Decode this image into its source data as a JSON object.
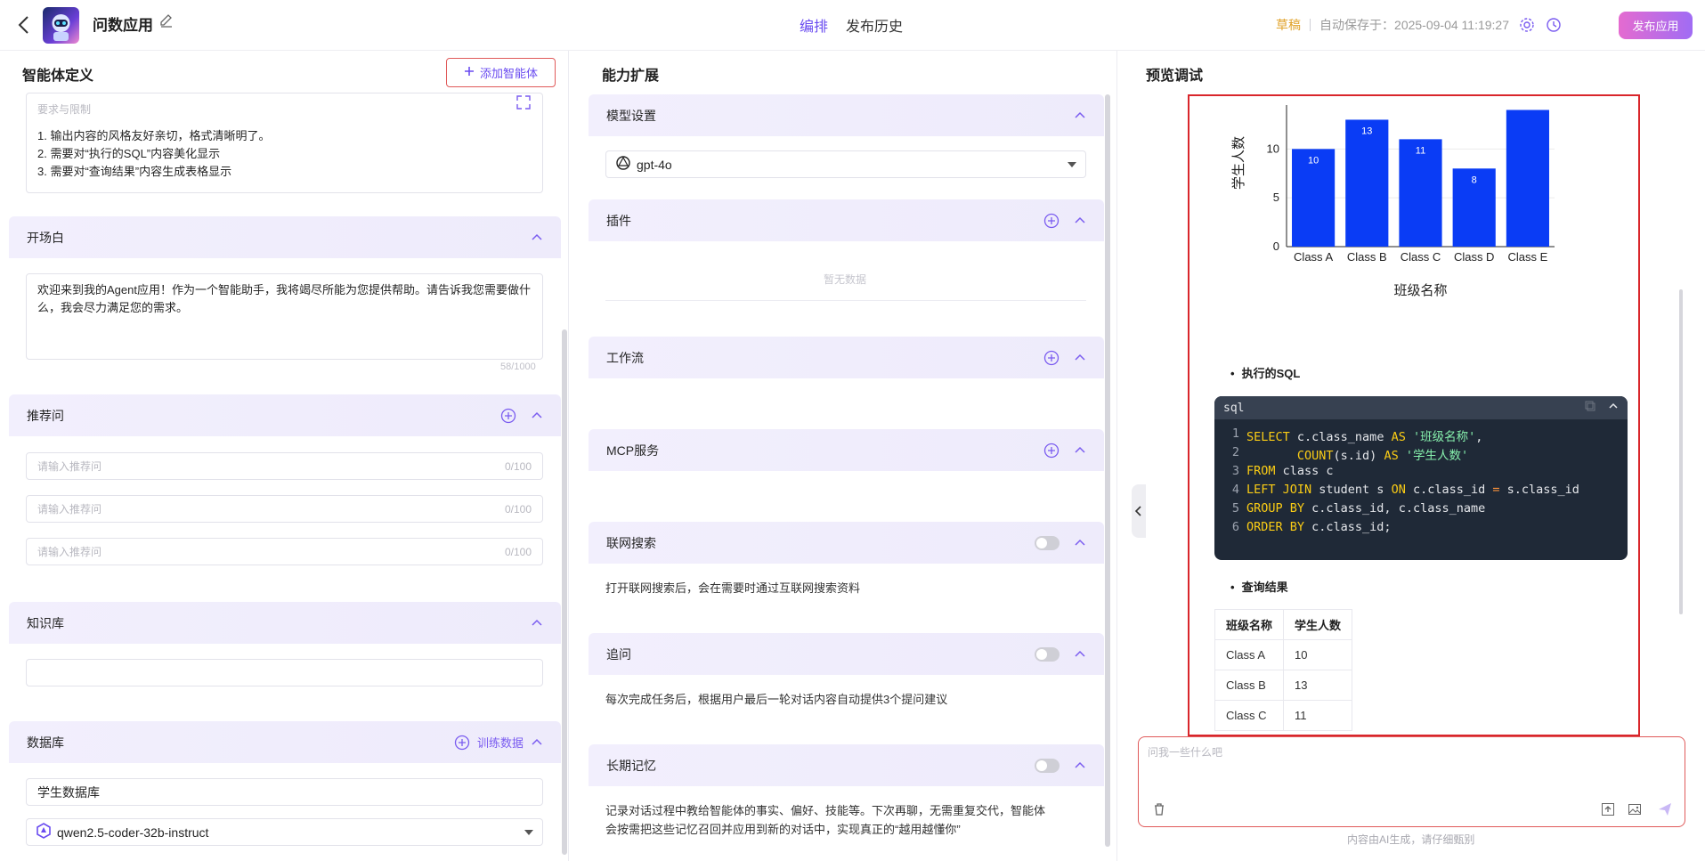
{
  "header": {
    "app_name": "问数应用",
    "tabs": [
      "编排",
      "发布历史"
    ],
    "draft_label": "草稿",
    "autosave": "自动保存于：2025-09-04 11:19:27",
    "publish_label": "发布应用"
  },
  "left": {
    "title": "智能体定义",
    "add_agent_label": "添加智能体",
    "requirements": {
      "placeholder": "要求与限制",
      "lines": [
        "1. 输出内容的风格友好亲切，格式清晰明了。",
        "2. 需要对“执行的SQL”内容美化显示",
        "3. 需要对“查询结果”内容生成表格显示"
      ]
    },
    "opening": {
      "title": "开场白",
      "text": "欢迎来到我的Agent应用！作为一个智能助手，我将竭尽所能为您提供帮助。请告诉我您需要做什么，我会尽力满足您的需求。",
      "counter": "58/1000"
    },
    "suggested": {
      "title": "推荐问",
      "placeholder": "请输入推荐问",
      "counter": "0/100"
    },
    "knowledge": {
      "title": "知识库"
    },
    "database": {
      "title": "数据库",
      "train_label": "训练数据",
      "db_name": "学生数据库",
      "model": "qwen2.5-coder-32b-instruct"
    }
  },
  "middle": {
    "title": "能力扩展",
    "model_section": "模型设置",
    "model": "gpt-4o",
    "plugins": {
      "title": "插件",
      "empty": "暂无数据"
    },
    "workflow": {
      "title": "工作流"
    },
    "mcp": {
      "title": "MCP服务"
    },
    "web_search": {
      "title": "联网搜索",
      "desc": "打开联网搜索后，会在需要时通过互联网搜索资料"
    },
    "followup": {
      "title": "追问",
      "desc": "每次完成任务后，根据用户最后一轮对话内容自动提供3个提问建议"
    },
    "memory": {
      "title": "长期记忆",
      "desc_1": "记录对话过程中教给智能体的事实、偏好、技能等。下次再聊，无需重复交代，智能体",
      "desc_2": "会按需把这些记忆召回并应用到新的对话中，实现真正的“越用越懂你”"
    }
  },
  "preview": {
    "title": "预览调试",
    "sql_bullet": "执行的SQL",
    "code_lang": "sql",
    "result_bullet": "查询结果",
    "table": {
      "headers": [
        "班级名称",
        "学生人数"
      ],
      "rows": [
        [
          "Class A",
          "10"
        ],
        [
          "Class B",
          "13"
        ],
        [
          "Class C",
          "11"
        ]
      ]
    },
    "chat_placeholder": "问我一些什么吧",
    "footer": "内容由AI生成，请仔细甄别"
  },
  "chart_data": {
    "type": "bar",
    "categories": [
      "Class A",
      "Class B",
      "Class C",
      "Class D",
      "Class E"
    ],
    "values": [
      10,
      13,
      11,
      8,
      14
    ],
    "data_labels": [
      "10",
      "13",
      "11",
      "8",
      ""
    ],
    "xlabel": "班级名称",
    "ylabel": "学生人数",
    "yticks": [
      0,
      5,
      10
    ],
    "ylim": [
      0,
      14.5
    ],
    "bar_color": "#0a3cf5"
  },
  "colors": {
    "accent": "#6a4cf0",
    "draft": "#e1a32b",
    "highlight_border": "#d9262b"
  }
}
